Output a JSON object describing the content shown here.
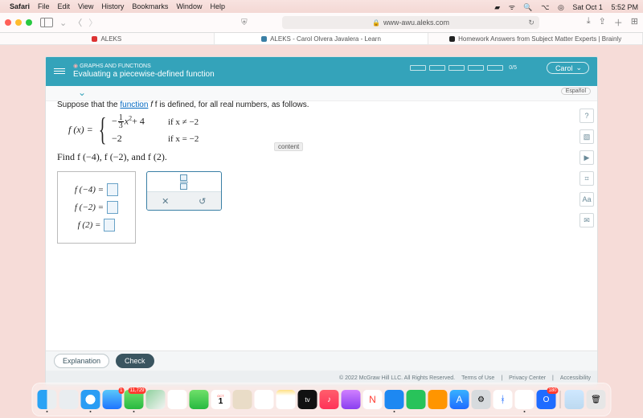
{
  "mac_menu": {
    "app": "Safari",
    "items": [
      "File",
      "Edit",
      "View",
      "History",
      "Bookmarks",
      "Window",
      "Help"
    ],
    "date": "Sat Oct 1",
    "time": "5:52 PM"
  },
  "browser": {
    "url": "www-awu.aleks.com",
    "url_prefix": "🔒"
  },
  "tabs": {
    "t1": "ALEKS",
    "t2": "ALEKS - Carol Olvera Javalera - Learn",
    "t3": "Homework Answers from Subject Matter Experts | Brainly"
  },
  "aleks": {
    "section": "GRAPHS AND FUNCTIONS",
    "title": "Evaluating a piecewise-defined function",
    "progress": "0/5",
    "user": "Carol",
    "lang": "Español",
    "prompt_pre": "Suppose that the ",
    "prompt_link": "function",
    "prompt_post": " f is defined, for all real numbers, as follows.",
    "fx": "f (x) =",
    "piece1_expr_pre": "−",
    "piece1_frac_n": "1",
    "piece1_frac_d": "3",
    "piece1_expr_post": "x",
    "piece1_sup": "2",
    "piece1_tail": "+ 4",
    "piece1_cond": "if x ≠ −2",
    "piece2_expr": "−2",
    "piece2_cond": "if x = −2",
    "task": "Find f (−4), f (−2), and f (2).",
    "ans1": "f (−4)  =",
    "ans2": "f (−2)  =",
    "ans3": "f (2)  =",
    "btn_expl": "Explanation",
    "btn_check": "Check",
    "copyright": "© 2022 McGraw Hill LLC. All Rights Reserved.",
    "f1": "Terms of Use",
    "f2": "Privacy Center",
    "f3": "Accessibility"
  },
  "overlay": "content"
}
